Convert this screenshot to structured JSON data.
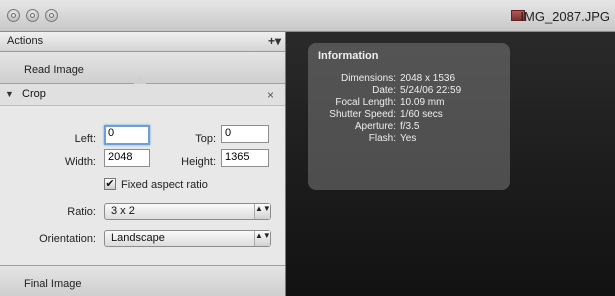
{
  "window": {
    "title": "IMG_2087.JPG"
  },
  "sidebar": {
    "header_label": "Actions",
    "add_menu_label": "+▾",
    "steps": {
      "read_image": "Read Image",
      "final_image": "Final Image"
    },
    "crop": {
      "title": "Crop",
      "close_glyph": "×",
      "disclosure_glyph": "▼",
      "left_label": "Left:",
      "left_value": "0",
      "top_label": "Top:",
      "top_value": "0",
      "width_label": "Width:",
      "width_value": "2048",
      "height_label": "Height:",
      "height_value": "1365",
      "fixed_aspect_label": "Fixed aspect ratio",
      "fixed_aspect_checked": true,
      "check_glyph": "✔",
      "ratio_label": "Ratio:",
      "ratio_value": "3 x 2",
      "orientation_label": "Orientation:",
      "orientation_value": "Landscape",
      "popup_arrows": "▲▼"
    }
  },
  "info": {
    "title": "Information",
    "rows": [
      {
        "key": "Dimensions:",
        "value": "2048 x 1536"
      },
      {
        "key": "Date:",
        "value": "5/24/06 22:59"
      },
      {
        "key": "Focal Length:",
        "value": "10.09 mm"
      },
      {
        "key": "Shutter Speed:",
        "value": "1/60 secs"
      },
      {
        "key": "Aperture:",
        "value": "f/3.5"
      },
      {
        "key": "Flash:",
        "value": "Yes"
      }
    ]
  }
}
